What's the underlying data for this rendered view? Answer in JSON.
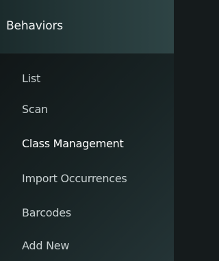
{
  "menu": {
    "title": "Behaviors",
    "items": [
      {
        "label": "List"
      },
      {
        "label": "Scan"
      },
      {
        "label": "Class Management",
        "active": true
      },
      {
        "label": "Import Occurrences"
      },
      {
        "label": "Barcodes"
      },
      {
        "label": "Add New"
      }
    ]
  },
  "colors": {
    "header_bg": "#243738",
    "panel_bg": "#182324",
    "text": "#c8d0d1",
    "active_text": "#ffffff"
  }
}
